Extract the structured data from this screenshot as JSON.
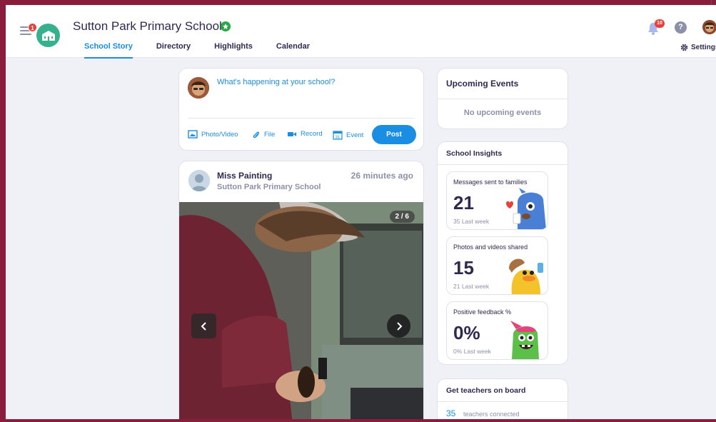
{
  "header": {
    "menu_badge": "1",
    "school_name": "Sutton Park Primary School",
    "notification_count": "10",
    "help_label": "?",
    "settings_label": "Settings",
    "tabs": [
      {
        "label": "School Story",
        "active": true
      },
      {
        "label": "Directory",
        "active": false
      },
      {
        "label": "Highlights",
        "active": false
      },
      {
        "label": "Calendar",
        "active": false
      }
    ]
  },
  "composer": {
    "prompt": "What's happening at your school?",
    "actions": {
      "photo_video": "Photo/Video",
      "file": "File",
      "record": "Record",
      "event": "Event"
    },
    "event_day": "31",
    "post_label": "Post"
  },
  "post": {
    "author": "Miss Painting",
    "school": "Sutton Park Primary School",
    "time": "26 minutes ago",
    "photo_counter": "2 / 6"
  },
  "upcoming_events": {
    "title": "Upcoming Events",
    "empty_text": "No upcoming events"
  },
  "insights": {
    "title": "School Insights",
    "stats": [
      {
        "label": "Messages sent to families",
        "value": "21",
        "sub": "35 Last week"
      },
      {
        "label": "Photos and videos shared",
        "value": "15",
        "sub": "21 Last week"
      },
      {
        "label": "Positive feedback %",
        "value": "0%",
        "sub": "0% Last week"
      }
    ]
  },
  "teachers": {
    "title": "Get teachers on board",
    "count": "35",
    "count_label": "teachers connected"
  },
  "colors": {
    "accent": "#1a8ee3",
    "frame": "#8a1d3c",
    "badge": "#e8413c",
    "logo": "#35b28d",
    "verified": "#28a745"
  },
  "icons": [
    "menu-icon",
    "school-logo-icon",
    "verified-icon",
    "bell-icon",
    "help-icon",
    "gear-icon",
    "photo-icon",
    "paperclip-icon",
    "video-camera-icon",
    "calendar-icon",
    "chevron-left-icon",
    "chevron-right-icon"
  ]
}
